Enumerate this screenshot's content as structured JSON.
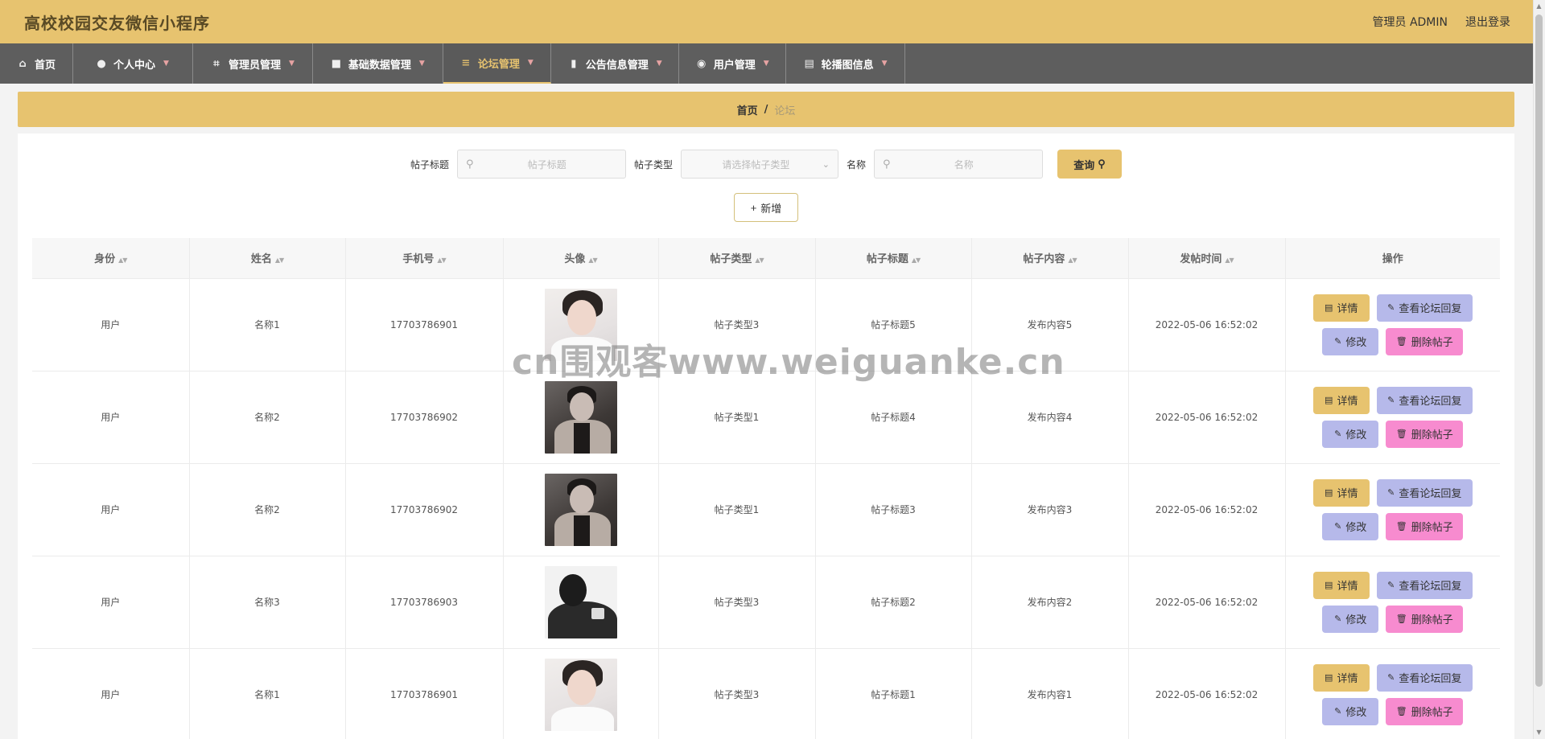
{
  "header": {
    "title": "高校校园交友微信小程序",
    "admin_label": "管理员 ADMIN",
    "logout_label": "退出登录"
  },
  "nav": {
    "items": [
      {
        "label": "首页",
        "icon": "home-icon"
      },
      {
        "label": "个人中心",
        "icon": "user-icon"
      },
      {
        "label": "管理员管理",
        "icon": "crop-icon"
      },
      {
        "label": "基础数据管理",
        "icon": "camera-icon"
      },
      {
        "label": "论坛管理",
        "icon": "layers-icon"
      },
      {
        "label": "公告信息管理",
        "icon": "chart-icon"
      },
      {
        "label": "用户管理",
        "icon": "location-icon"
      },
      {
        "label": "轮播图信息",
        "icon": "document-icon"
      }
    ],
    "active_index": 4
  },
  "breadcrumb": {
    "home": "首页",
    "separator": "/",
    "current": "论坛"
  },
  "search": {
    "title_label": "帖子标题",
    "title_placeholder": "帖子标题",
    "type_label": "帖子类型",
    "type_placeholder": "请选择帖子类型",
    "name_label": "名称",
    "name_placeholder": "名称",
    "search_button": "查询"
  },
  "add_button": "新增",
  "table": {
    "columns": [
      "身份",
      "姓名",
      "手机号",
      "头像",
      "帖子类型",
      "帖子标题",
      "帖子内容",
      "发帖时间",
      "操作"
    ],
    "rows": [
      {
        "role": "用户",
        "name": "名称1",
        "phone": "17703786901",
        "avatar": "light",
        "type": "帖子类型3",
        "title": "帖子标题5",
        "content": "发布内容5",
        "time": "2022-05-06 16:52:02"
      },
      {
        "role": "用户",
        "name": "名称2",
        "phone": "17703786902",
        "avatar": "dark",
        "type": "帖子类型1",
        "title": "帖子标题4",
        "content": "发布内容4",
        "time": "2022-05-06 16:52:02"
      },
      {
        "role": "用户",
        "name": "名称2",
        "phone": "17703786902",
        "avatar": "dark",
        "type": "帖子类型1",
        "title": "帖子标题3",
        "content": "发布内容3",
        "time": "2022-05-06 16:52:02"
      },
      {
        "role": "用户",
        "name": "名称3",
        "phone": "17703786903",
        "avatar": "silhouette",
        "type": "帖子类型3",
        "title": "帖子标题2",
        "content": "发布内容2",
        "time": "2022-05-06 16:52:02"
      },
      {
        "role": "用户",
        "name": "名称1",
        "phone": "17703786901",
        "avatar": "light",
        "type": "帖子类型3",
        "title": "帖子标题1",
        "content": "发布内容1",
        "time": "2022-05-06 16:52:02"
      }
    ],
    "actions": {
      "detail": "详情",
      "view_reply": "查看论坛回复",
      "edit": "修改",
      "delete": "删除帖子"
    }
  },
  "watermark": "cn围观客www.weiguanke.cn",
  "colors": {
    "primary": "#e7c36f",
    "nav_bg": "#5e5e5e",
    "action_purple": "#b6b9ea",
    "action_pink": "#f78bcf"
  }
}
